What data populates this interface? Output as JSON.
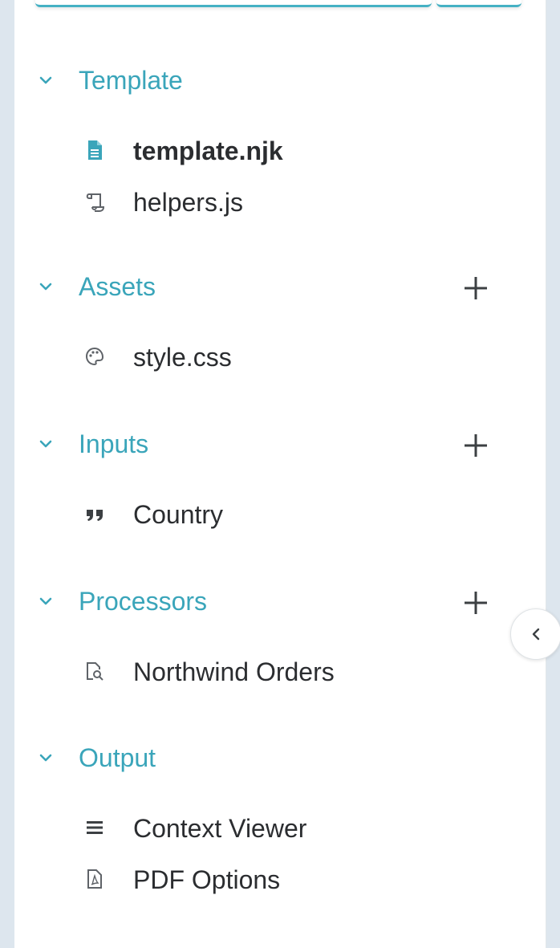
{
  "sections": {
    "template": {
      "title": "Template",
      "items": [
        {
          "label": "template.njk",
          "icon": "file-text-icon",
          "active": true
        },
        {
          "label": "helpers.js",
          "icon": "script-scroll-icon"
        }
      ]
    },
    "assets": {
      "title": "Assets",
      "add": "plus-icon",
      "items": [
        {
          "label": "style.css",
          "icon": "palette-icon"
        }
      ]
    },
    "inputs": {
      "title": "Inputs",
      "add": "plus-icon",
      "items": [
        {
          "label": "Country",
          "icon": "quote-icon"
        }
      ]
    },
    "processors": {
      "title": "Processors",
      "add": "plus-icon",
      "items": [
        {
          "label": "Northwind Orders",
          "icon": "file-search-icon"
        }
      ]
    },
    "output": {
      "title": "Output",
      "items": [
        {
          "label": "Context Viewer",
          "icon": "lines-icon"
        },
        {
          "label": "PDF Options",
          "icon": "pdf-file-icon"
        }
      ]
    }
  },
  "colors": {
    "accent": "#3aa5ba",
    "text": "#2b2d30",
    "icon": "#5f6368",
    "background": "#dde6ee"
  }
}
